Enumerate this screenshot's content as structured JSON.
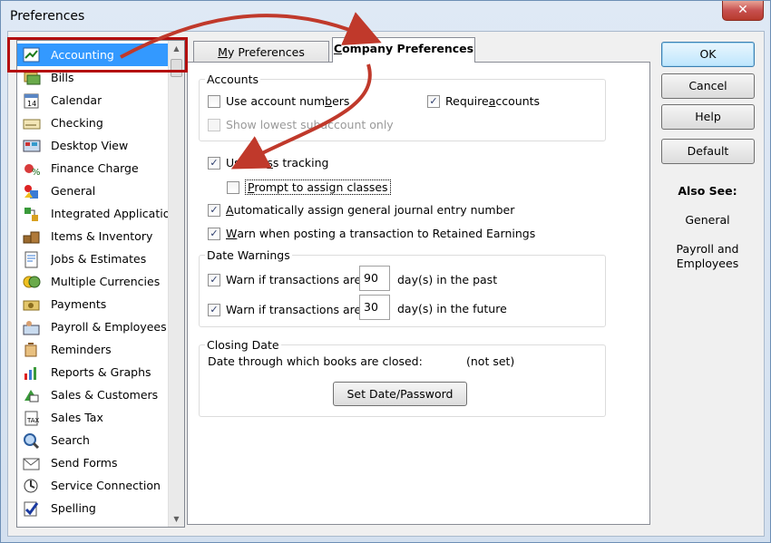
{
  "window": {
    "title": "Preferences",
    "close_glyph": "✕"
  },
  "sidebar": {
    "items": [
      {
        "label": "Accounting",
        "icon": "accounting-icon",
        "selected": true
      },
      {
        "label": "Bills",
        "icon": "bills-icon"
      },
      {
        "label": "Calendar",
        "icon": "calendar-icon"
      },
      {
        "label": "Checking",
        "icon": "checking-icon"
      },
      {
        "label": "Desktop View",
        "icon": "desktop-view-icon"
      },
      {
        "label": "Finance Charge",
        "icon": "finance-charge-icon"
      },
      {
        "label": "General",
        "icon": "general-icon"
      },
      {
        "label": "Integrated Application",
        "icon": "integrated-applications-icon"
      },
      {
        "label": "Items & Inventory",
        "icon": "items-inventory-icon"
      },
      {
        "label": "Jobs & Estimates",
        "icon": "jobs-estimates-icon"
      },
      {
        "label": "Multiple Currencies",
        "icon": "multiple-currencies-icon"
      },
      {
        "label": "Payments",
        "icon": "payments-icon"
      },
      {
        "label": "Payroll & Employees",
        "icon": "payroll-employees-icon"
      },
      {
        "label": "Reminders",
        "icon": "reminders-icon"
      },
      {
        "label": "Reports & Graphs",
        "icon": "reports-graphs-icon"
      },
      {
        "label": "Sales & Customers",
        "icon": "sales-customers-icon"
      },
      {
        "label": "Sales Tax",
        "icon": "sales-tax-icon"
      },
      {
        "label": "Search",
        "icon": "search-icon"
      },
      {
        "label": "Send Forms",
        "icon": "send-forms-icon"
      },
      {
        "label": "Service Connection",
        "icon": "service-connection-icon"
      },
      {
        "label": "Spelling",
        "icon": "spelling-icon"
      }
    ]
  },
  "tabs": {
    "my_prefix": "",
    "my_key": "M",
    "my_rest": "y Preferences",
    "company_prefix": "",
    "company_key": "C",
    "company_rest": "ompany Preferences"
  },
  "accounts": {
    "title": "Accounts",
    "use_account_numbers": {
      "pre": "Use account num",
      "key": "b",
      "post": "ers",
      "checked": false
    },
    "require_accounts": {
      "pre": "Require ",
      "key": "a",
      "post": "ccounts",
      "checked": true
    },
    "show_lowest": {
      "label": "Show lowest subaccount only",
      "checked": false,
      "disabled": true
    }
  },
  "class_tracking": {
    "use_class_tracking": {
      "pre": "Use cla",
      "key": "s",
      "post": "s tracking",
      "checked": true
    },
    "prompt_assign": {
      "key": "P",
      "post": "rompt to assign classes",
      "checked": false
    },
    "auto_journal": {
      "key": "A",
      "post": "utomatically assign general journal entry number",
      "checked": true
    },
    "warn_retained": {
      "key": "W",
      "post": "arn when posting a transaction to Retained Earnings",
      "checked": true
    }
  },
  "date_warnings": {
    "title": "Date Warnings",
    "past": {
      "label": "Warn if transactions are",
      "value": "90",
      "suffix": "day(s) in the past",
      "checked": true
    },
    "future": {
      "label": "Warn if transactions are",
      "value": "30",
      "suffix": "day(s) in the future",
      "checked": true
    }
  },
  "closing_date": {
    "title": "Closing Date",
    "label": "Date through which books are closed:",
    "value": "(not set)",
    "button": "Set Date/Password"
  },
  "buttons": {
    "ok": "OK",
    "cancel": "Cancel",
    "help": "Help",
    "default": "Default"
  },
  "also_see": {
    "title": "Also See:",
    "links": [
      "General",
      "Payroll and",
      "Employees"
    ]
  },
  "colors": {
    "selection": "#3399ff",
    "annotation": "#b40f0f",
    "arrow": "#c0392b"
  }
}
